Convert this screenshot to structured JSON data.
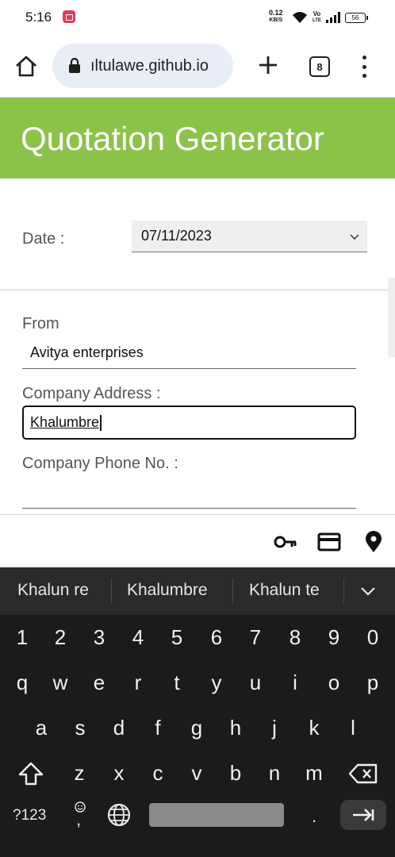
{
  "status_bar": {
    "time": "5:16",
    "net_speed_value": "0.12",
    "net_speed_unit": "KB/S",
    "volte_line1": "Vo",
    "volte_line2": "LTE",
    "battery": "56"
  },
  "browser": {
    "url": "ıltulawe.github.io",
    "tab_count": "8"
  },
  "page": {
    "title": "Quotation Generator",
    "banner_color": "#8bc34a",
    "date_label": "Date :",
    "date_value": "07/11/2023",
    "from_label": "From",
    "from_value": "Avitya enterprises",
    "address_label": "Company Address :",
    "address_value": "Khalumbre",
    "phone_label": "Company Phone No. :",
    "phone_value": ""
  },
  "keyboard": {
    "suggestions": [
      "Khalun re",
      "Khalumbre",
      "Khalun te"
    ],
    "number_row": [
      "1",
      "2",
      "3",
      "4",
      "5",
      "6",
      "7",
      "8",
      "9",
      "0"
    ],
    "row1": [
      "q",
      "w",
      "e",
      "r",
      "t",
      "y",
      "u",
      "i",
      "o",
      "p"
    ],
    "row2": [
      "a",
      "s",
      "d",
      "f",
      "g",
      "h",
      "j",
      "k",
      "l"
    ],
    "row3": [
      "z",
      "x",
      "c",
      "v",
      "b",
      "n",
      "m"
    ],
    "symbols_key": "?123",
    "comma_key": ",",
    "period_key": "."
  }
}
